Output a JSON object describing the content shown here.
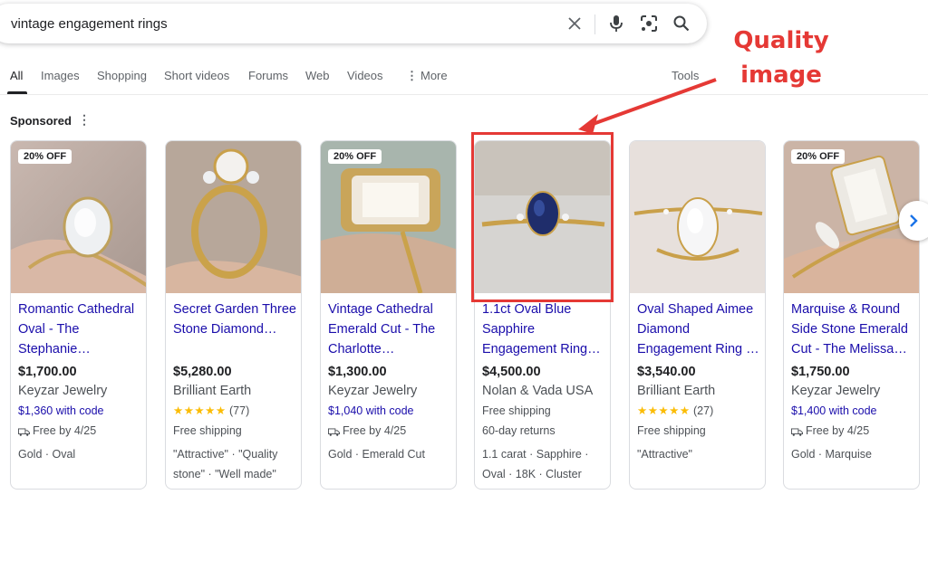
{
  "search": {
    "query": "vintage engagement rings"
  },
  "tabs": [
    {
      "label": "All",
      "active": true
    },
    {
      "label": "Images"
    },
    {
      "label": "Shopping"
    },
    {
      "label": "Short videos"
    },
    {
      "label": "Forums"
    },
    {
      "label": "Web"
    },
    {
      "label": "Videos"
    },
    {
      "label": "More"
    }
  ],
  "tools_label": "Tools",
  "sponsored_label": "Sponsored",
  "annotation": {
    "line1": "Quality",
    "line2": "image",
    "color": "#e53935"
  },
  "colors": {
    "link": "#1a0dab",
    "star": "#fbbc04",
    "annotation": "#e53935"
  },
  "products": [
    {
      "badge": "20% OFF",
      "title": "Romantic Cathedral Oval - The Stephanie…",
      "price": "$1,700.00",
      "seller": "Keyzar Jewelry",
      "line1": "$1,360 with code",
      "line2": "Free by 4/25",
      "line3": "Gold · Oval",
      "line4": ""
    },
    {
      "badge": "",
      "title": "Secret Garden Three Stone Diamond…",
      "price": "$5,280.00",
      "seller": "Brilliant Earth",
      "rating_stars": "★★★★★",
      "rating_count": "(77)",
      "line2": "Free shipping",
      "line3": "\"Attractive\" · \"Quality",
      "line4": "stone\" · \"Well made\""
    },
    {
      "badge": "20% OFF",
      "title": "Vintage Cathedral Emerald Cut - The Charlotte…",
      "price": "$1,300.00",
      "seller": "Keyzar Jewelry",
      "line1": "$1,040 with code",
      "line2": "Free by 4/25",
      "line3": "Gold · Emerald Cut",
      "line4": ""
    },
    {
      "badge": "",
      "title": "1.1ct Oval Blue Sapphire Engagement Ring…",
      "price": "$4,500.00",
      "seller": "Nolan & Vada USA",
      "line1": "Free shipping",
      "line2": "60-day returns",
      "line3": "1.1 carat · Sapphire ·",
      "line4": "Oval · 18K · Cluster"
    },
    {
      "badge": "",
      "title": "Oval Shaped Aimee Diamond Engagement Ring …",
      "price": "$3,540.00",
      "seller": "Brilliant Earth",
      "rating_stars": "★★★★★",
      "rating_count": "(27)",
      "line2": "Free shipping",
      "line3": "\"Attractive\"",
      "line4": ""
    },
    {
      "badge": "20% OFF",
      "title": "Marquise & Round Side Stone Emerald Cut - The Melissa…",
      "price": "$1,750.00",
      "seller": "Keyzar Jewelry",
      "line1": "$1,400 with code",
      "line2": "Free by 4/25",
      "line3": "Gold · Marquise",
      "line4": ""
    }
  ]
}
